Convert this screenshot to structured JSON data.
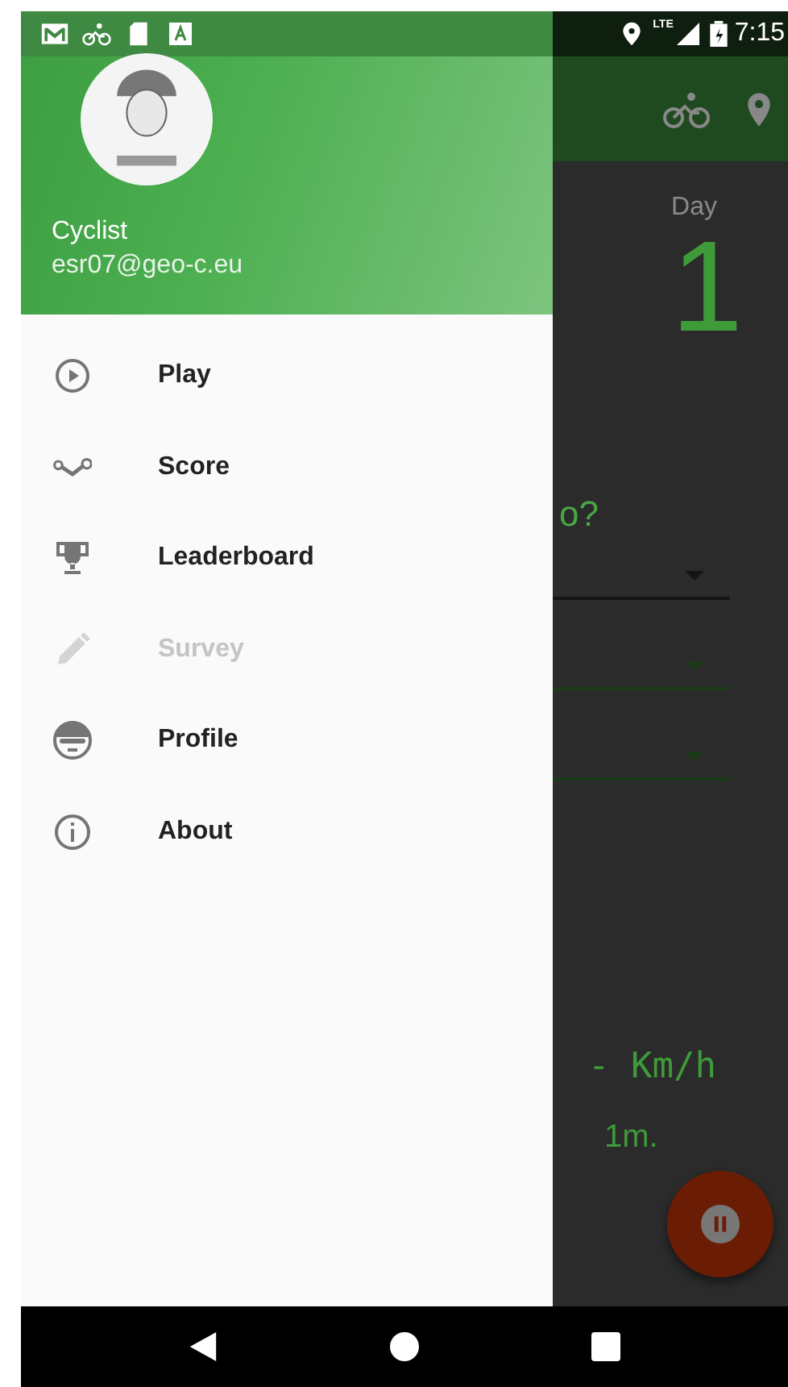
{
  "status_bar": {
    "network": "LTE",
    "time": "7:15"
  },
  "background_screen": {
    "day_label": "Day",
    "day_value": "1",
    "question": "o?",
    "dropdowns": [
      {
        "kind": "plain"
      },
      {
        "kind": "accent"
      },
      {
        "kind": "accent"
      }
    ],
    "speed": "- Km/h",
    "distance": "1m."
  },
  "drawer": {
    "user_name": "Cyclist",
    "email": "esr07@geo-c.eu",
    "items": [
      {
        "kind": "play",
        "label": "Play",
        "disabled": false
      },
      {
        "kind": "score",
        "label": "Score",
        "disabled": false
      },
      {
        "kind": "trophy",
        "label": "Leaderboard",
        "disabled": false
      },
      {
        "kind": "pencil",
        "label": "Survey",
        "disabled": true
      },
      {
        "kind": "profile",
        "label": "Profile",
        "disabled": false
      },
      {
        "kind": "info",
        "label": "About",
        "disabled": false
      }
    ]
  }
}
